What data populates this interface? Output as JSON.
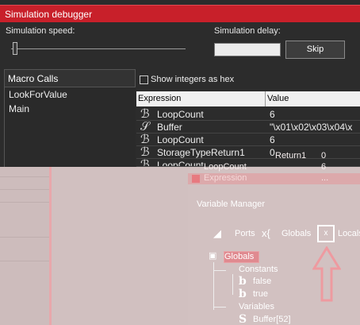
{
  "window": {
    "title": "Simulation debugger"
  },
  "controls": {
    "speed_label": "Simulation speed:",
    "delay_label": "Simulation delay:",
    "delay_value": "",
    "skip_label": "Skip",
    "speed_level": 0.02
  },
  "macro_calls": {
    "header": "Macro Calls",
    "items": [
      "LookForValue",
      "Main"
    ]
  },
  "options": {
    "show_integers_hex_label": "Show integers as hex",
    "show_integers_hex_checked": false
  },
  "grid": {
    "columns": [
      "Expression",
      "Value"
    ],
    "rows": [
      {
        "icon": "ℬ",
        "expression": "LoopCount",
        "value": "6"
      },
      {
        "icon": "𝒮",
        "expression": "Buffer",
        "value": "\"\\x01\\x02\\x03\\x04\\x"
      },
      {
        "icon": "ℬ",
        "expression": "LoopCount",
        "value": "6"
      },
      {
        "icon": "ℬ",
        "expression": "StorageTypeReturn1",
        "value": "0"
      },
      {
        "icon": "ℬ",
        "expression": "LoopCount",
        "value": ""
      }
    ]
  },
  "overlay_rows": [
    {
      "name": "Return1",
      "value": "0"
    },
    {
      "name": "LoopCount",
      "value": "6"
    },
    {
      "name": "Expression",
      "value": "...",
      "selected": true
    }
  ],
  "variable_manager": {
    "title": "Variable Manager",
    "tabs": [
      {
        "icon": "ports-icon",
        "label": "Ports"
      },
      {
        "icon": "globals-icon",
        "label": "Globals"
      },
      {
        "icon": "locals-icon",
        "label": "Locals"
      }
    ],
    "tree": {
      "root": "Globals",
      "constants_label": "Constants",
      "constants": [
        "false",
        "true"
      ],
      "variables_label": "Variables",
      "variables": [
        "Buffer[52]"
      ]
    }
  },
  "colors": {
    "title_bar": "#c8202a",
    "panel_dark": "#2c2c2c",
    "faded_bg": "#d8c7c7",
    "highlight": "#e08a90"
  }
}
